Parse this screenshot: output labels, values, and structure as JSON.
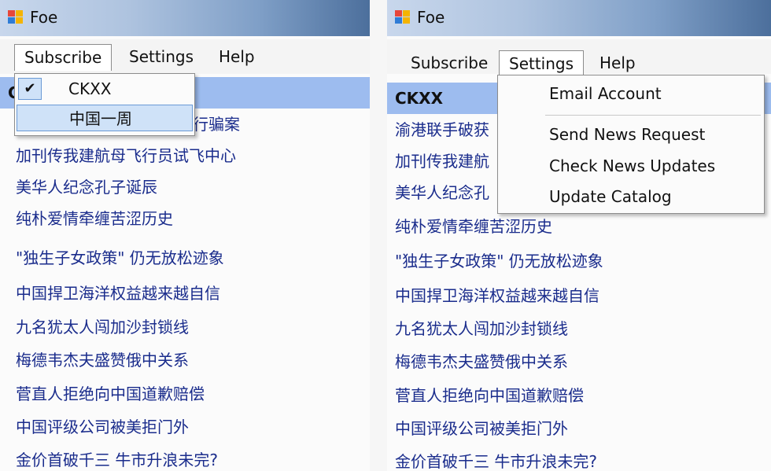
{
  "left": {
    "title": "Foe",
    "menu": [
      "Subscribe",
      "Settings",
      "Help"
    ],
    "dropdown": {
      "checkmark": "✔",
      "items": [
        "CKXX",
        "中国一周"
      ]
    },
    "selected_row_partial": "C",
    "rows": [
      "行骗案",
      "加刊传我建航母飞行员试飞中心",
      "美华人纪念孔子诞辰",
      "纯朴爱情牵缠苦涩历史",
      "\"独生子女政策\" 仍无放松迹象",
      "中国捍卫海洋权益越来越自信",
      "九名犹太人闯加沙封锁线",
      "梅德韦杰夫盛赞俄中关系",
      "菅直人拒绝向中国道歉赔偿",
      "中国评级公司被美拒门外",
      "金价首破千三 牛市升浪未完?"
    ]
  },
  "right": {
    "title": "Foe",
    "menu": [
      "Subscribe",
      "Settings",
      "Help"
    ],
    "dropdown": {
      "items": [
        "Email Account",
        "Send News Request",
        "Check News Updates",
        "Update Catalog"
      ]
    },
    "selected_row": "CKXX",
    "rows": [
      "渝港联手破获",
      "加刊传我建航",
      "美华人纪念孔",
      "纯朴爱情牵缠苦涩历史",
      "\"独生子女政策\" 仍无放松迹象",
      "中国捍卫海洋权益越来越自信",
      "九名犹太人闯加沙封锁线",
      "梅德韦杰夫盛赞俄中关系",
      "菅直人拒绝向中国道歉赔偿",
      "中国评级公司被美拒门外",
      "金价首破千三 牛市升浪未完?"
    ]
  },
  "colors": {
    "selection": "#9dbcef",
    "link_text": "#1a2c8c",
    "menu_highlight": "#cfe2f8"
  }
}
